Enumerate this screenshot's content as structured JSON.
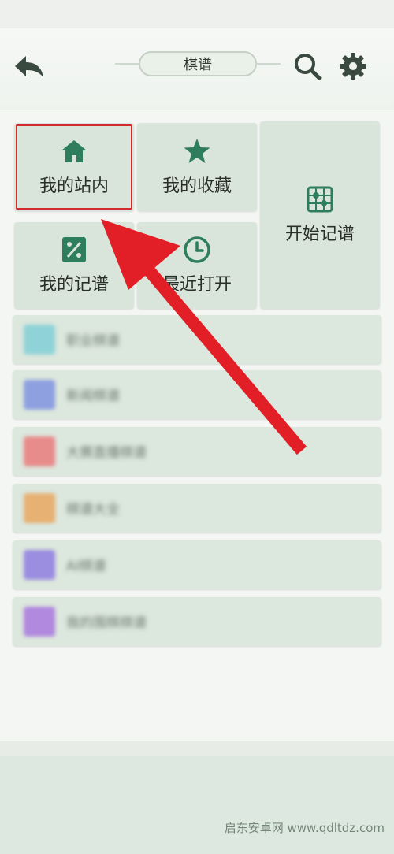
{
  "header": {
    "title": "棋谱",
    "back_icon": "back-arrow-icon",
    "search_icon": "search-icon",
    "settings_icon": "gear-icon"
  },
  "tiles": [
    {
      "label": "我的站内",
      "icon": "home-icon",
      "highlighted": true
    },
    {
      "label": "我的收藏",
      "icon": "star-icon"
    },
    {
      "label": "开始记谱",
      "icon": "go-board-icon"
    },
    {
      "label": "我的记谱",
      "icon": "record-book-icon"
    },
    {
      "label": "最近打开",
      "icon": "clock-icon"
    }
  ],
  "list": [
    {
      "label": "职业棋谱",
      "thumb_color": "#8fd3d8"
    },
    {
      "label": "新闻棋谱",
      "thumb_color": "#8ea0e0"
    },
    {
      "label": "大赛直播棋谱",
      "thumb_color": "#e88b8b"
    },
    {
      "label": "棋谱大全",
      "thumb_color": "#e6b173"
    },
    {
      "label": "AI棋谱",
      "thumb_color": "#9b8de0"
    },
    {
      "label": "我的围棋棋谱",
      "thumb_color": "#b189de"
    }
  ],
  "watermark": "启东安卓网 www.qdltdz.com",
  "colors": {
    "accent_green": "#2e7d5b",
    "highlight_red": "#d32c2c",
    "tile_bg": "#d9e5da"
  }
}
